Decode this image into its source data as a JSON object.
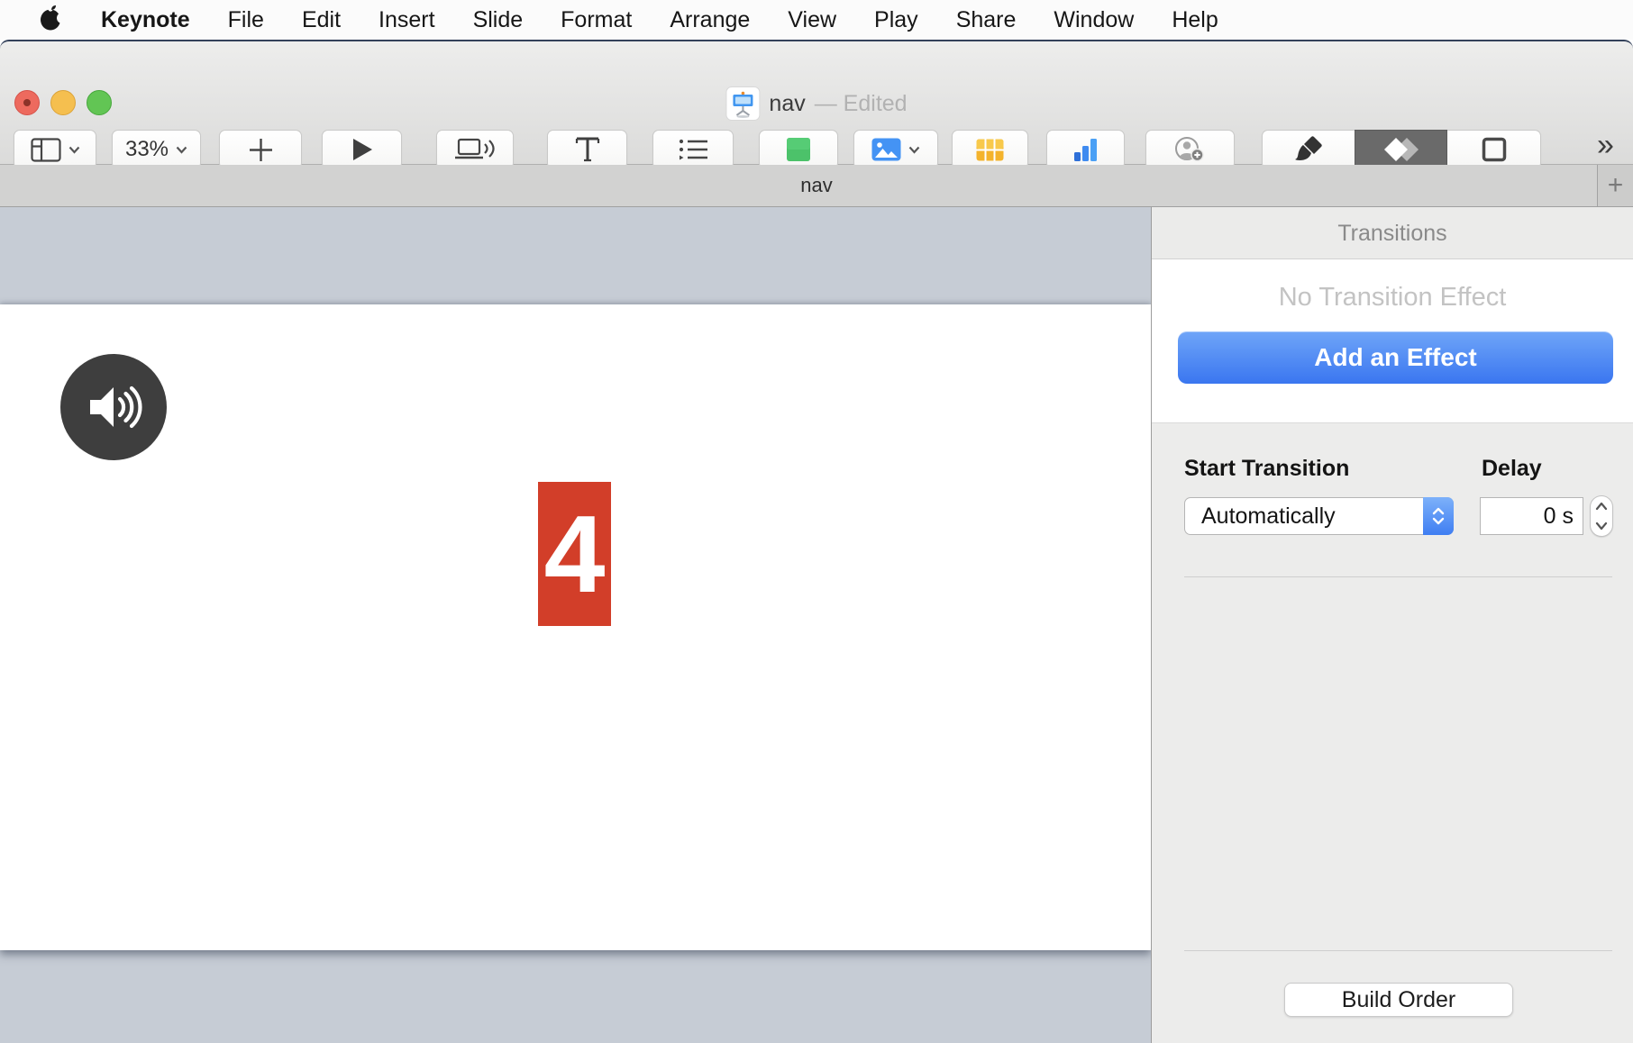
{
  "menu_bar": {
    "apple_icon": "apple-logo",
    "items": [
      "Keynote",
      "File",
      "Edit",
      "Insert",
      "Slide",
      "Format",
      "Arrange",
      "View",
      "Play",
      "Share",
      "Window",
      "Help"
    ]
  },
  "title_bar": {
    "document_icon": "keynote-doc-icon",
    "title": "nav",
    "edited_suffix": "— Edited"
  },
  "toolbar": {
    "items": [
      {
        "id": "view",
        "label": "View",
        "icon": "layout-view-icon"
      },
      {
        "id": "zoom",
        "label": "Zoom",
        "value": "33%"
      },
      {
        "id": "add-slide",
        "label": "Add Slide",
        "icon": "plus-icon"
      },
      {
        "id": "play",
        "label": "Play",
        "icon": "play-icon"
      },
      {
        "id": "keynote-live",
        "label": "Keynote Live",
        "icon": "keynote-live-icon"
      },
      {
        "id": "text",
        "label": "Text",
        "icon": "text-icon",
        "glyph": "T"
      },
      {
        "id": "object-list",
        "label": "Object List",
        "icon": "object-list-icon"
      },
      {
        "id": "shape",
        "label": "Shape",
        "icon": "shape-icon"
      },
      {
        "id": "media",
        "label": "Media",
        "icon": "media-icon"
      },
      {
        "id": "table",
        "label": "Table",
        "icon": "table-icon"
      },
      {
        "id": "chart",
        "label": "Chart",
        "icon": "chart-icon"
      },
      {
        "id": "collaborate",
        "label": "Collaborate",
        "icon": "collaborate-icon"
      },
      {
        "id": "format",
        "label": "Format",
        "icon": "format-brush-icon",
        "selected": false
      },
      {
        "id": "animate",
        "label": "Animate",
        "icon": "animate-diamond-icon",
        "selected": true
      },
      {
        "id": "document",
        "label": "Document",
        "icon": "document-square-icon",
        "selected": false
      }
    ],
    "overflow_label": "»"
  },
  "tab_bar": {
    "active_document": "nav",
    "add_button": "+"
  },
  "canvas": {
    "audio_icon": "speaker-audio-icon",
    "slide_number_badge": "4"
  },
  "transitions_panel": {
    "title": "Transitions",
    "empty_state": "No Transition Effect",
    "add_effect_button": "Add an Effect",
    "start_transition": {
      "label": "Start Transition",
      "value": "Automatically"
    },
    "delay": {
      "label": "Delay",
      "value": "0 s"
    },
    "build_order_button": "Build Order"
  },
  "colors": {
    "accent_blue": "#3d79f0",
    "slide_badge_red": "#d23e29",
    "canvas_background": "#c6ccd5",
    "selected_tool_background": "#6a6a6a",
    "traffic_red": "#ed6a5e",
    "traffic_yellow": "#f5bf4f",
    "traffic_green": "#62c554"
  }
}
